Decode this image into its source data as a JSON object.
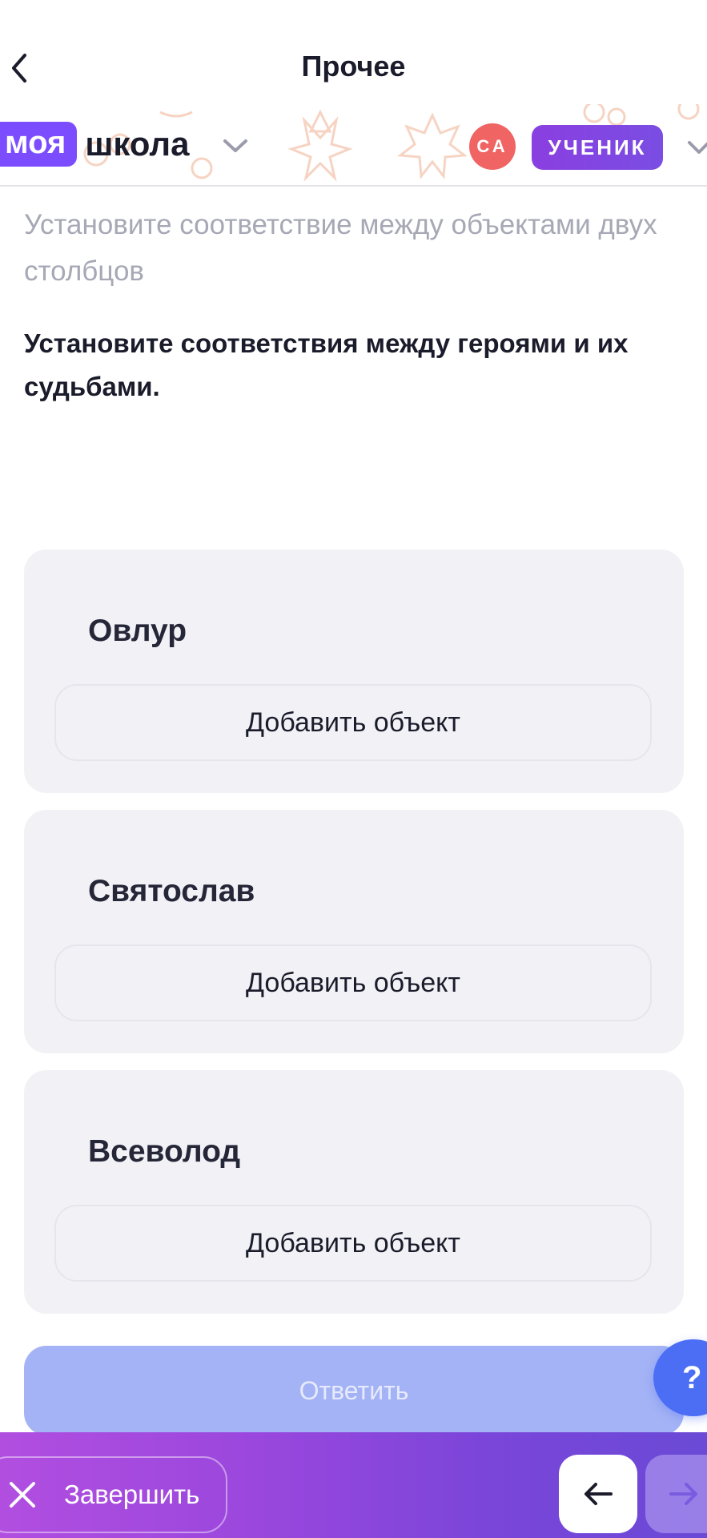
{
  "header": {
    "title": "Прочее",
    "back_icon": "chevron-left-icon"
  },
  "school_bar": {
    "brand_part1": "моя",
    "brand_part2": "школа",
    "avatar_initials": "СА",
    "role": "УЧЕНИК",
    "colors": {
      "brand": "#7b4dff",
      "avatar": "#f06464",
      "role": "#8a3fe0"
    }
  },
  "task": {
    "instruction": "Установите соответствие между объектами двух столбцов",
    "question": "Установите соответствия между героями и их судьбами."
  },
  "cards": [
    {
      "title": "Овлур",
      "add_label": "Добавить объект"
    },
    {
      "title": "Святослав",
      "add_label": "Добавить объект"
    },
    {
      "title": "Всеволод",
      "add_label": "Добавить объект"
    }
  ],
  "answer_label": "Ответить",
  "help_label": "?",
  "bottom_bar": {
    "finish_label": "Завершить",
    "prev_icon": "arrow-left-icon",
    "next_icon": "arrow-right-icon"
  }
}
